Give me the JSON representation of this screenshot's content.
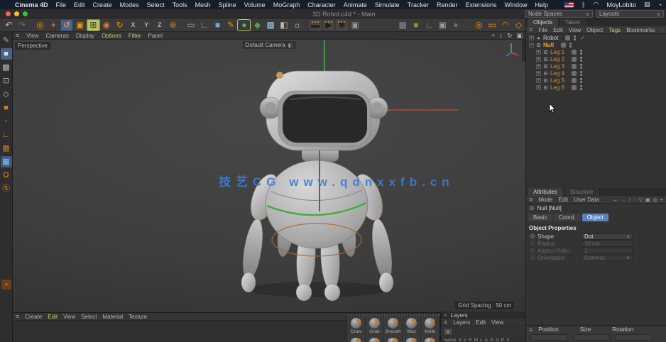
{
  "ui": {
    "hamburger": "≡",
    "chevron": "∨",
    "close": "×",
    "plus": "+"
  },
  "menubar": {
    "app": "Cinema 4D",
    "items": [
      {
        "t": "File"
      },
      {
        "t": "Edit"
      },
      {
        "t": "Create"
      },
      {
        "t": "Modes"
      },
      {
        "t": "Select"
      },
      {
        "t": "Tools"
      },
      {
        "t": "Mesh"
      },
      {
        "t": "Spline"
      },
      {
        "t": "Volume"
      },
      {
        "t": "MoGraph"
      },
      {
        "t": "Character"
      },
      {
        "t": "Animate"
      },
      {
        "t": "Simulate"
      },
      {
        "t": "Tracker"
      },
      {
        "t": "Render"
      },
      {
        "t": "Extensions"
      },
      {
        "t": "Window"
      },
      {
        "t": "Help"
      }
    ],
    "status_icons": [
      {
        "g": "ᛒ",
        "name": "bluetooth-icon"
      },
      {
        "g": "◠",
        "name": "wifi-icon"
      }
    ],
    "username": "MoyLobito",
    "right_icons": [
      {
        "g": "▤",
        "name": "display-icon"
      },
      {
        "g": "◔",
        "name": "control-center-icon"
      }
    ]
  },
  "titlebar": {
    "title": "3D Robot.c4d * - Main",
    "dropdowns": [
      {
        "t": "Node Spaces",
        "name": "node-spaces-select"
      },
      {
        "t": "Layouts",
        "name": "layouts-select"
      }
    ]
  },
  "toolbar": {
    "buttons": [
      {
        "g": "↶",
        "fg": "#b8b8b8",
        "name": "undo-button"
      },
      {
        "g": "↷",
        "fg": "#6a6a6a",
        "name": "redo-button"
      },
      {
        "cls": "sp"
      },
      {
        "g": "◎",
        "fg": "#e8921a",
        "name": "live-selection-tool"
      },
      {
        "g": "+",
        "fg": "#e8921a",
        "name": "move-tool"
      },
      {
        "g": "↺",
        "fg": "#f0a23c",
        "bg": "#49648c",
        "cls": "on",
        "name": "rotate-tool"
      },
      {
        "g": "▣",
        "fg": "#e8921a",
        "name": "scale-tool"
      },
      {
        "g": "⊞",
        "fg": "#33361f",
        "bg": "#b9c35f",
        "cls": "on",
        "name": "axis-modification-tool"
      },
      {
        "g": "◉",
        "fg": "#cf7e2e",
        "name": "simulation-tool"
      },
      {
        "g": "↻",
        "fg": "#e8921a",
        "name": "rotate-band-tool"
      },
      {
        "g": "X",
        "fg": "#b0b0b0",
        "cls": "ax",
        "name": "lock-x-axis"
      },
      {
        "g": "Y",
        "fg": "#b0b0b0",
        "cls": "ax",
        "name": "lock-y-axis"
      },
      {
        "g": "Z",
        "fg": "#b0b0b0",
        "cls": "ax",
        "name": "lock-z-axis"
      },
      {
        "g": "⊕",
        "fg": "#cf7e2e",
        "name": "coordinate-system-toggle"
      },
      {
        "cls": "sp"
      },
      {
        "g": "▭",
        "fg": "#9a9a9a",
        "name": "stage-icon"
      },
      {
        "g": "∟",
        "fg": "#7fb2e5",
        "name": "coordinates-icon"
      },
      {
        "g": "■",
        "fg": "#6fa8dc",
        "name": "add-cube-button"
      },
      {
        "g": "✎",
        "fg": "#e8921a",
        "name": "spline-pen-button"
      },
      {
        "g": "●",
        "fg": "#58b858",
        "cls": "outl",
        "name": "subdivision-surface-button"
      },
      {
        "g": "◆",
        "fg": "#4aa34a",
        "name": "deformer-button"
      },
      {
        "g": "▦",
        "fg": "#9ec7e8",
        "name": "floor-button"
      },
      {
        "g": "◧",
        "fg": "#b5b5b5",
        "name": "camera-button"
      },
      {
        "g": "☼",
        "fg": "#d8d2a8",
        "name": "light-button"
      },
      {
        "cls": "sp"
      },
      {
        "g": "▬",
        "fg": "#1f1f1f",
        "bg": "#454545",
        "cls": "clap",
        "name": "render-view-button"
      },
      {
        "g": "▶",
        "fg": "#1f1f1f",
        "bg": "#454545",
        "cls": "clap",
        "name": "render-button"
      },
      {
        "g": "✱",
        "fg": "#1f1f1f",
        "bg": "#454545",
        "cls": "clap",
        "name": "render-settings-button"
      },
      {
        "g": "▣",
        "fg": "#9a9a9a",
        "name": "picture-viewer-button"
      },
      {
        "cls": "sp"
      },
      {
        "cls": "sp"
      },
      {
        "cls": "sp"
      },
      {
        "cls": "sp"
      },
      {
        "cls": "sp"
      },
      {
        "cls": "sp"
      },
      {
        "cls": "sp"
      },
      {
        "g": "▩",
        "fg": "#8a8a8a",
        "name": "checker-material-icon"
      },
      {
        "g": "■",
        "fg": "#8a8f3a",
        "name": "olive-material-icon"
      },
      {
        "g": "∟",
        "fg": "#c87a30",
        "name": "axis-workplane-icon"
      },
      {
        "g": "▣",
        "fg": "#9a9a9a",
        "name": "workplane-icon"
      },
      {
        "g": "●",
        "fg": "#6f6f6f",
        "name": "snap-icon"
      },
      {
        "cls": "sp"
      },
      {
        "cls": "sp"
      },
      {
        "g": "◎",
        "fg": "#e8921a",
        "name": "live-selection-button"
      },
      {
        "g": "▭",
        "fg": "#e8921a",
        "name": "rectangle-selection-button"
      },
      {
        "g": "◠",
        "fg": "#e8921a",
        "name": "lasso-selection-button"
      },
      {
        "g": "◇",
        "fg": "#e8921a",
        "name": "polygon-selection-button"
      }
    ]
  },
  "leftdock": {
    "buttons": [
      {
        "g": "✎",
        "fg": "#a8a8a8",
        "name": "tweak-mode"
      },
      {
        "g": "■",
        "fg": "#d8d8d8",
        "bg": "#49648c",
        "cls": "on",
        "name": "model-mode"
      },
      {
        "g": "▩",
        "fg": "#b8b8b8",
        "name": "texture-mode"
      },
      {
        "g": "⊡",
        "fg": "#b8b8b8",
        "name": "points-mode"
      },
      {
        "g": "◇",
        "fg": "#b8b8b8",
        "name": "edges-mode"
      },
      {
        "g": "■",
        "fg": "#c87a30",
        "name": "polygons-mode"
      },
      {
        "g": "▪",
        "fg": "#7a4a22",
        "name": "model-object-mode"
      },
      {
        "g": "∟",
        "fg": "#e8921a",
        "name": "enable-axis-mode"
      },
      {
        "g": "▦",
        "fg": "#c87a30",
        "name": "texture-axis-mode"
      },
      {
        "g": "▦",
        "fg": "#8fc1ea",
        "bg": "#3c5a7c",
        "cls": "on",
        "name": "workplane-mode"
      },
      {
        "g": "Ω",
        "fg": "#e8921a",
        "name": "snap-magnet-toggle"
      },
      {
        "g": "Ⓢ",
        "fg": "#e8921a",
        "name": "snap-settings-toggle"
      }
    ]
  },
  "viewport": {
    "menu": [
      {
        "t": "View"
      },
      {
        "t": "Cameras"
      },
      {
        "t": "Display"
      },
      {
        "t": "Options",
        "cls": "hl"
      },
      {
        "t": "Filter",
        "cls": "hl"
      },
      {
        "t": "Panel"
      }
    ],
    "nav_icons": [
      {
        "g": "+",
        "name": "pan-view-icon"
      },
      {
        "g": "↕",
        "name": "zoom-view-icon"
      },
      {
        "g": "↻",
        "name": "rotate-view-icon"
      },
      {
        "g": "▣",
        "name": "toggle-view-icon"
      }
    ],
    "view_label": "Perspective",
    "camera_label": "Default Camera",
    "camera_icon": "◧",
    "grid_label": "Grid Spacing : 50 cm",
    "watermark": "技艺CG www.qdnxxfb.cn"
  },
  "object_manager": {
    "tabs": [
      {
        "t": "Objects",
        "cls": "active"
      },
      {
        "t": "Takes"
      }
    ],
    "menu": [
      {
        "t": "File"
      },
      {
        "t": "Edit"
      },
      {
        "t": "View"
      },
      {
        "t": "Object"
      },
      {
        "t": "Tags",
        "cls": "hl"
      },
      {
        "t": "Bookmarks"
      }
    ],
    "icons": [
      {
        "g": "◌",
        "name": "search-icon"
      },
      {
        "g": "⌂",
        "name": "home-icon"
      },
      {
        "g": "▽",
        "name": "filter-icon"
      },
      {
        "g": "+",
        "name": "add-icon"
      }
    ],
    "items": [
      {
        "exp": "+",
        "icon": "●",
        "ifg": "#5db55d",
        "t": "Robot",
        "ind": 0,
        "tag": "✓",
        "name": "tree-item-robot"
      },
      {
        "exp": "−",
        "icon": "⊙",
        "ifg": "#bcd0e8",
        "t": "Null",
        "ind": 0,
        "cls": "sel",
        "name": "tree-item-null"
      },
      {
        "exp": "+",
        "icon": "⊙",
        "ifg": "#bcd0e8",
        "t": "Leg 1",
        "ind": 1,
        "cls": "child",
        "name": "tree-item-leg-1"
      },
      {
        "exp": "+",
        "icon": "⊙",
        "ifg": "#bcd0e8",
        "t": "Leg 2",
        "ind": 1,
        "cls": "child",
        "name": "tree-item-leg-2"
      },
      {
        "exp": "+",
        "icon": "⊙",
        "ifg": "#bcd0e8",
        "t": "Leg 3",
        "ind": 1,
        "cls": "child",
        "name": "tree-item-leg-3"
      },
      {
        "exp": "+",
        "icon": "⊙",
        "ifg": "#bcd0e8",
        "t": "Leg 4",
        "ind": 1,
        "cls": "child",
        "name": "tree-item-leg-4"
      },
      {
        "exp": "+",
        "icon": "⊙",
        "ifg": "#bcd0e8",
        "t": "Leg 5",
        "ind": 1,
        "cls": "child",
        "name": "tree-item-leg-5"
      },
      {
        "exp": "+",
        "icon": "⊙",
        "ifg": "#bcd0e8",
        "t": "Leg 6",
        "ind": 1,
        "cls": "child",
        "name": "tree-item-leg-6"
      }
    ]
  },
  "attributes": {
    "tabs": [
      {
        "t": "Attributes",
        "cls": "active"
      },
      {
        "t": "Structure"
      }
    ],
    "menu": [
      {
        "t": "Mode"
      },
      {
        "t": "Edit"
      },
      {
        "t": "User Data"
      }
    ],
    "icons": [
      {
        "g": "←",
        "name": "back-icon"
      },
      {
        "g": "→",
        "name": "forward-icon",
        "cls": "dim"
      },
      {
        "g": "↑",
        "name": "up-icon"
      },
      {
        "g": "◌",
        "name": "search-icon"
      },
      {
        "g": "▽",
        "name": "filter-icon"
      },
      {
        "g": "▣",
        "name": "lock-icon"
      },
      {
        "g": "◎",
        "name": "settings-icon"
      },
      {
        "g": "+",
        "name": "add-icon"
      }
    ],
    "object_icon": "⊙",
    "object_label": "Null [Null]",
    "subtabs": [
      {
        "t": "Basic"
      },
      {
        "t": "Coord."
      },
      {
        "t": "Object",
        "cls": "active"
      }
    ],
    "section": "Object Properties",
    "props": [
      {
        "label": "Shape",
        "value": "Dot",
        "cls": "select on",
        "name": "shape-select"
      },
      {
        "label": "Radius",
        "value": "10 cm",
        "cls": "input off",
        "name": "radius-field"
      },
      {
        "label": "Aspect Ratio",
        "value": "1",
        "cls": "input off",
        "name": "aspect-ratio-field"
      },
      {
        "label": "Orientation",
        "value": "Camera",
        "cls": "select off",
        "name": "orientation-select"
      }
    ]
  },
  "materials": {
    "menu": [
      {
        "t": "Create"
      },
      {
        "t": "Edit",
        "cls": "hl"
      },
      {
        "t": "View"
      },
      {
        "t": "Select"
      },
      {
        "t": "Material"
      },
      {
        "t": "Texture"
      }
    ]
  },
  "sculpt": {
    "brushes": [
      {
        "t": "Draw"
      },
      {
        "t": "Grab"
      },
      {
        "t": "Smooth"
      },
      {
        "t": "Wax"
      },
      {
        "t": "Knife"
      }
    ]
  },
  "layers": {
    "title": "Layers",
    "menu": [
      {
        "t": "Layers"
      },
      {
        "t": "Edit"
      },
      {
        "t": "View"
      }
    ],
    "columns": [
      {
        "t": "Name"
      },
      {
        "t": "S"
      },
      {
        "t": "V"
      },
      {
        "t": "R"
      },
      {
        "t": "M"
      },
      {
        "t": "L"
      },
      {
        "t": "A"
      },
      {
        "t": "G"
      },
      {
        "t": "D"
      },
      {
        "t": "E"
      },
      {
        "t": "X"
      }
    ]
  },
  "coordinates": {
    "headers": [
      {
        "t": "Position"
      },
      {
        "t": "Size"
      },
      {
        "t": "Rotation"
      }
    ]
  },
  "colors": {
    "accent": "#e8921a",
    "menu_highlight": "#c7cc66",
    "selection_blue": "#5b82b8",
    "selected_object_text": "#e8a43c",
    "watermark_blue": "#3b7dd8"
  }
}
